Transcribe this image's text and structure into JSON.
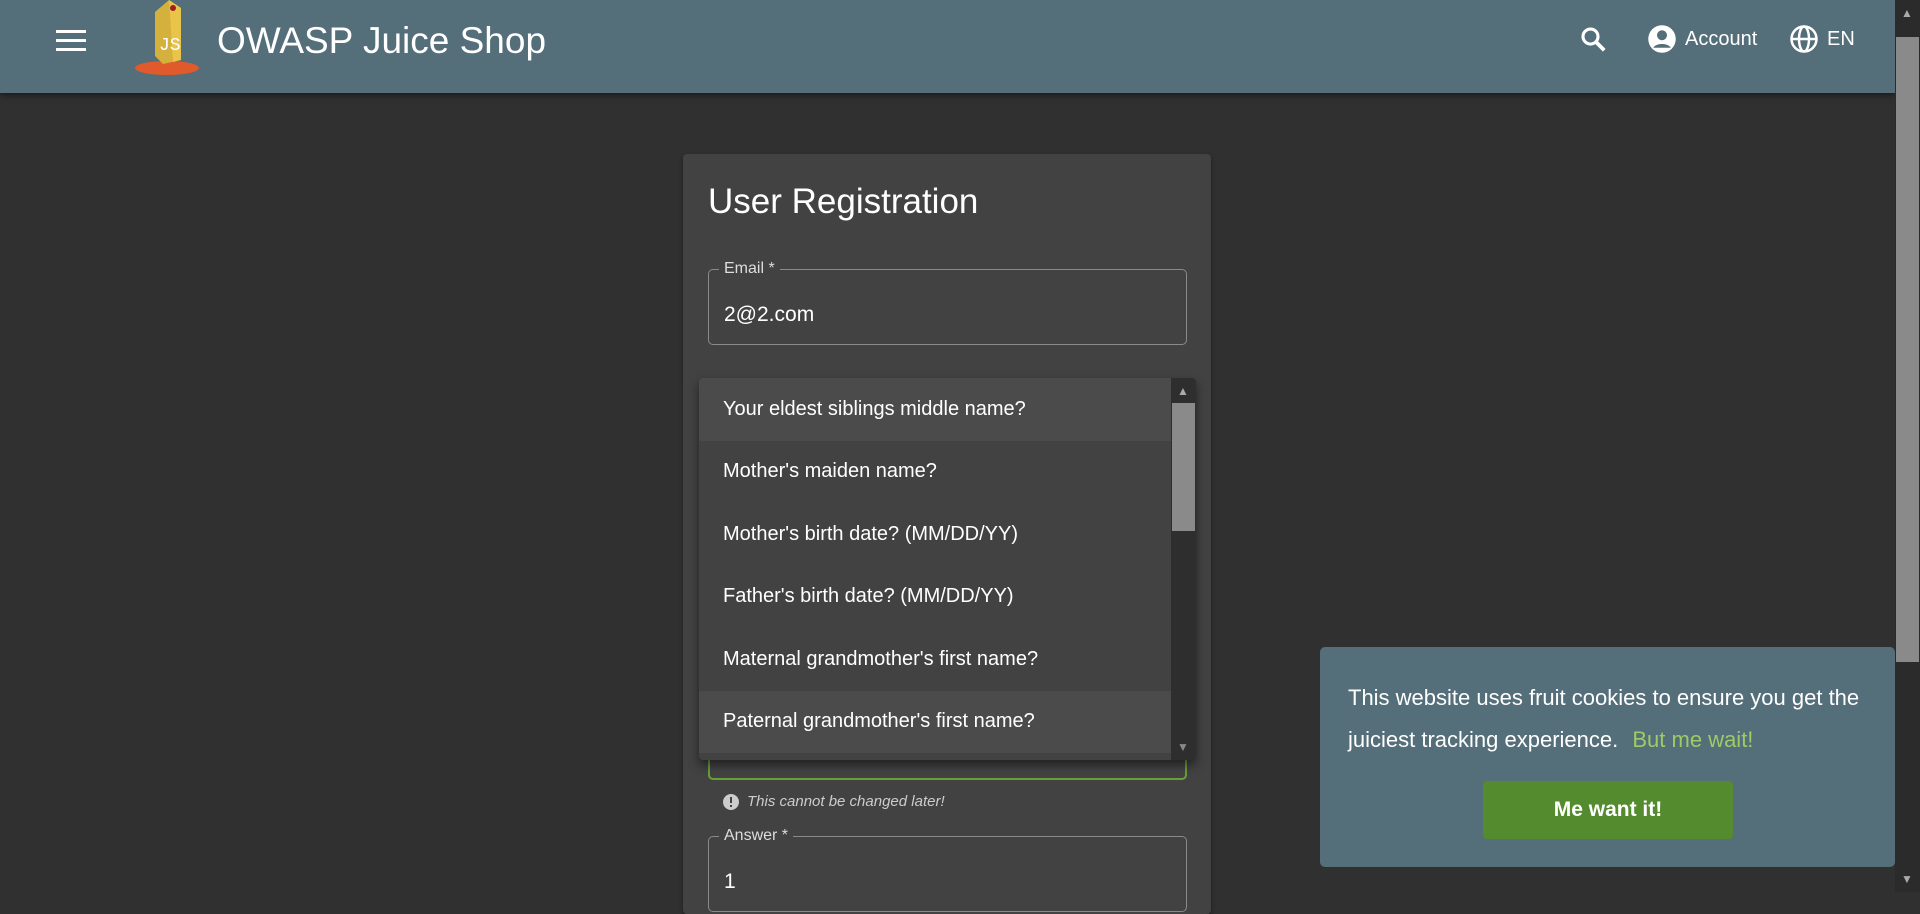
{
  "header": {
    "title": "OWASP Juice Shop",
    "account_label": "Account",
    "language_label": "EN"
  },
  "form": {
    "title": "User Registration",
    "email_label": "Email *",
    "email_value": "2@2.com",
    "hint": "This cannot be changed later!",
    "answer_label": "Answer *",
    "answer_value": "1"
  },
  "dropdown": {
    "options": [
      "Your eldest siblings middle name?",
      "Mother's maiden name?",
      "Mother's birth date? (MM/DD/YY)",
      "Father's birth date? (MM/DD/YY)",
      "Maternal grandmother's first name?",
      "Paternal grandmother's first name?"
    ]
  },
  "cookie": {
    "message": "This website uses fruit cookies to ensure you get the juiciest tracking experience.",
    "link": "But me wait!",
    "button": "Me want it!"
  },
  "colors": {
    "toolbar": "#546e7a",
    "accent": "#558b2f",
    "link": "#9ccc65"
  }
}
